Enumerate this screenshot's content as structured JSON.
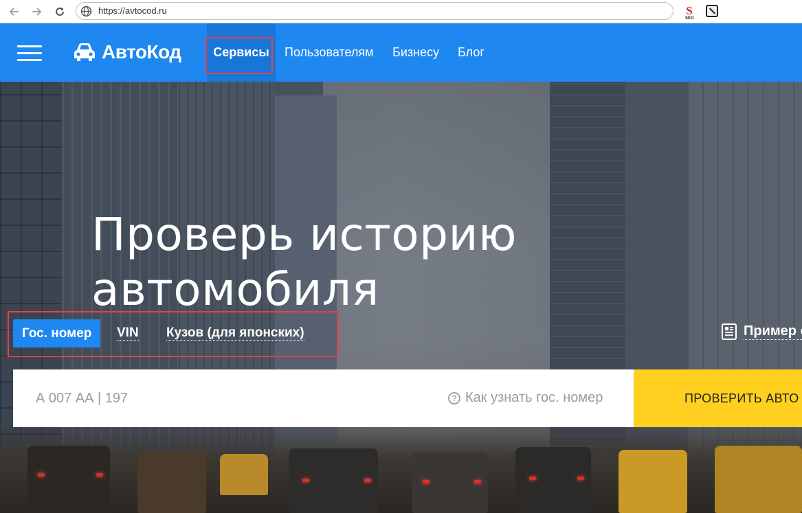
{
  "browser": {
    "url": "https://avtocod.ru",
    "icons": [
      "back-arrow-icon",
      "forward-arrow-icon",
      "reload-icon",
      "globe-icon",
      "seo-extension-icon",
      "extension-icon"
    ],
    "seo_label": "S",
    "seo_sub": "SEO"
  },
  "header": {
    "logo_text": "АвтоКод",
    "nav": [
      {
        "label": "Сервисы",
        "active": true
      },
      {
        "label": "Пользователям"
      },
      {
        "label": "Бизнесу"
      },
      {
        "label": "Блог"
      }
    ],
    "colors": {
      "header_bg": "#1e87f0",
      "active_bg": "#1976d9",
      "highlight": "#e5404a"
    }
  },
  "hero": {
    "title": "Проверь историю автомобиля",
    "tabs": [
      {
        "label": "Гос. номер",
        "active": true
      },
      {
        "label": "VIN"
      },
      {
        "label": "Кузов (для японских)"
      }
    ],
    "sample_label": "Пример о",
    "search": {
      "placeholder": "А 007 АА | 197",
      "help_text": "Как узнать гос. номер",
      "button_label": "ПРОВЕРИТЬ АВТО"
    },
    "colors": {
      "button_bg": "#ffd01f",
      "tab_active_bg": "#1e87f0"
    }
  }
}
